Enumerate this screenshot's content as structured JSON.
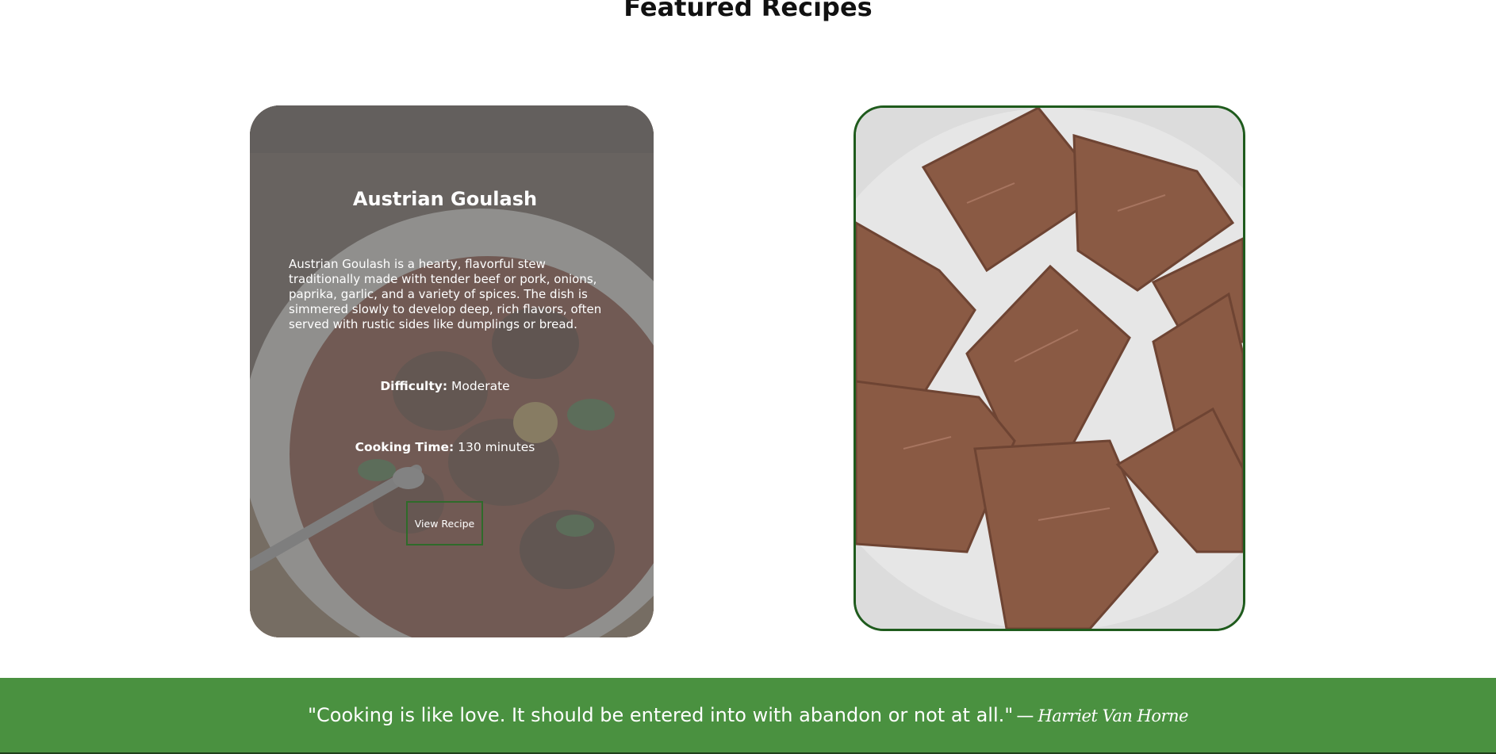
{
  "page": {
    "section_title": "Featured Recipes"
  },
  "recipes": [
    {
      "title": "Austrian Goulash",
      "description": "Austrian Goulash is a hearty, flavorful stew traditionally made with tender beef or pork, onions, paprika, garlic, and a variety of spices. The dish is simmered slowly to develop deep, rich flavors, often served with rustic sides like dumplings or bread.",
      "difficulty_label": "Difficulty:",
      "difficulty_value": "Moderate",
      "cooking_time_label": "Cooking Time:",
      "cooking_time_value": "130 minutes",
      "button_label": "View Recipe",
      "image_icon": "goulash-photo"
    },
    {
      "image_icon": "chocolate-fudge-photo"
    }
  ],
  "footer": {
    "quote": "\"Cooking is like love. It should be entered into with abandon or not at all.\"",
    "dash": "—",
    "author": "Harriet Van Horne"
  },
  "colors": {
    "accent_green": "#4a9140",
    "card_border_green": "#1f5b1d",
    "button_border_green": "#2f6b2a"
  }
}
